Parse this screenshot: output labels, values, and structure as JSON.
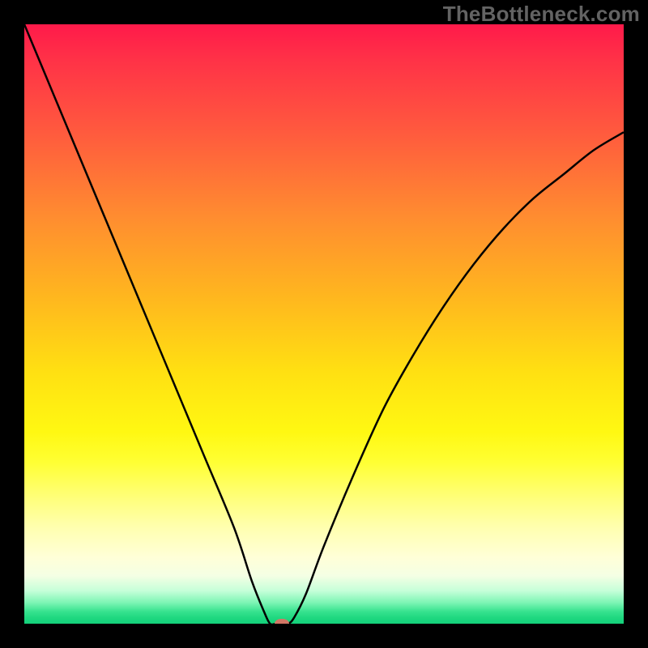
{
  "watermark": "TheBottleneck.com",
  "chart_data": {
    "type": "line",
    "title": "",
    "xlabel": "",
    "ylabel": "",
    "xlim": [
      0,
      100
    ],
    "ylim": [
      0,
      100
    ],
    "series": [
      {
        "name": "bottleneck-curve",
        "x": [
          0,
          5,
          10,
          15,
          20,
          25,
          30,
          35,
          38,
          40,
          41,
          42,
          43,
          44,
          45,
          47,
          50,
          55,
          60,
          65,
          70,
          75,
          80,
          85,
          90,
          95,
          100
        ],
        "values": [
          100,
          88,
          76,
          64,
          52,
          40,
          28,
          16,
          7,
          2,
          0,
          0,
          0,
          0,
          1,
          5,
          13,
          25,
          36,
          45,
          53,
          60,
          66,
          71,
          75,
          79,
          82
        ]
      }
    ],
    "background_gradient_stops": [
      {
        "pos": 0,
        "color": "#ff1a4a"
      },
      {
        "pos": 6,
        "color": "#ff3247"
      },
      {
        "pos": 18,
        "color": "#ff5a3e"
      },
      {
        "pos": 32,
        "color": "#ff8c30"
      },
      {
        "pos": 45,
        "color": "#ffb51f"
      },
      {
        "pos": 58,
        "color": "#ffe012"
      },
      {
        "pos": 68,
        "color": "#fff812"
      },
      {
        "pos": 73,
        "color": "#ffff33"
      },
      {
        "pos": 79,
        "color": "#ffff7a"
      },
      {
        "pos": 84,
        "color": "#ffffb0"
      },
      {
        "pos": 89,
        "color": "#ffffd8"
      },
      {
        "pos": 92,
        "color": "#f4ffe4"
      },
      {
        "pos": 94.5,
        "color": "#c6ffd9"
      },
      {
        "pos": 96.5,
        "color": "#7cf5b4"
      },
      {
        "pos": 98,
        "color": "#36e28e"
      },
      {
        "pos": 99,
        "color": "#1fd880"
      },
      {
        "pos": 100,
        "color": "#14d07a"
      }
    ],
    "marker": {
      "x": 43,
      "y": 0,
      "color": "#d27766"
    },
    "curve_color": "#000000",
    "curve_stroke_width": 2.5,
    "frame_color": "#000000"
  }
}
